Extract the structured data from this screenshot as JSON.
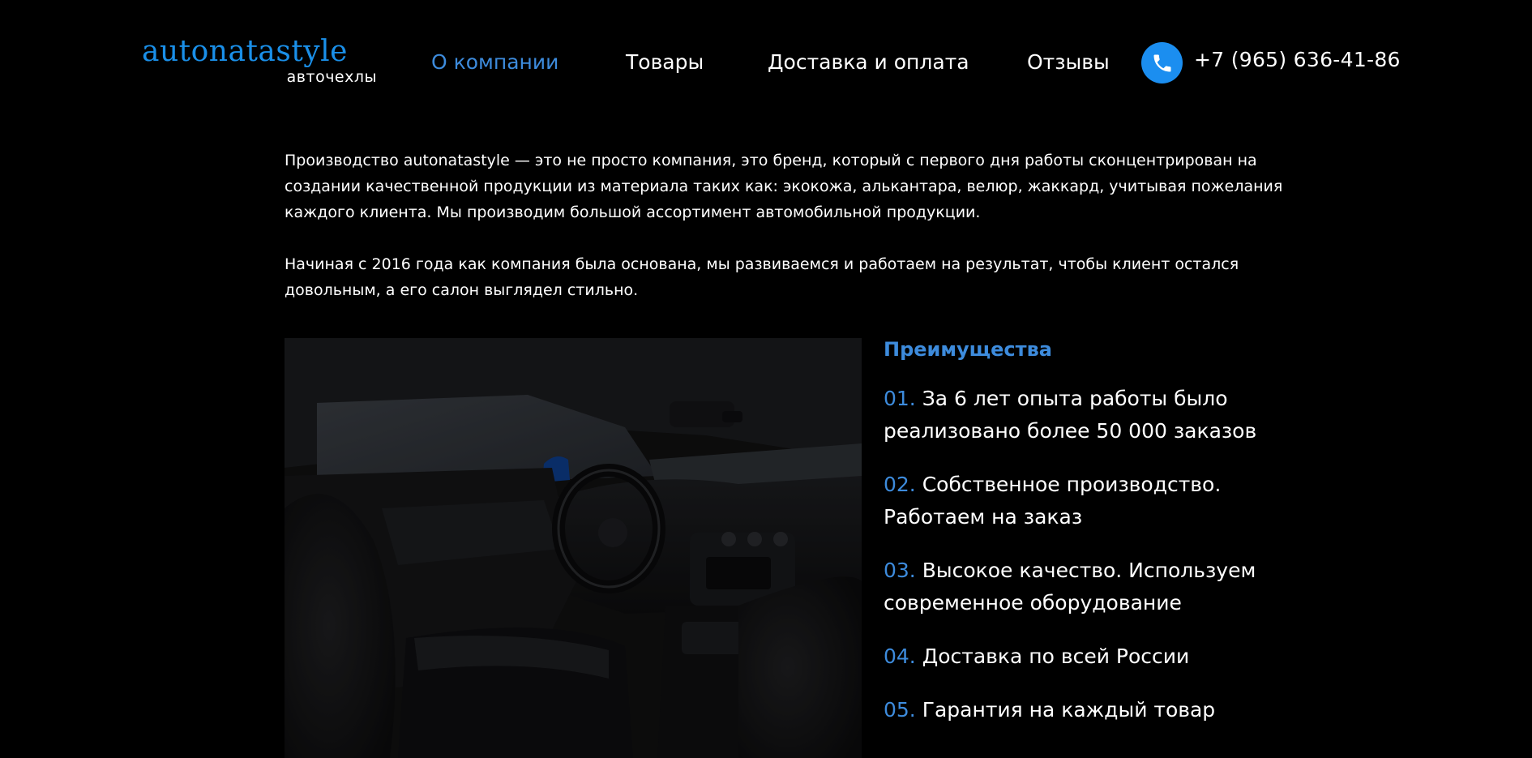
{
  "header": {
    "logo_main": "autonatastyle",
    "logo_sub": "авточехлы",
    "nav": [
      {
        "label": "О компании",
        "active": true
      },
      {
        "label": "Товары",
        "active": false
      },
      {
        "label": "Доставка и оплата",
        "active": false
      },
      {
        "label": "Отзывы",
        "active": false
      }
    ],
    "phone": "+7 (965) 636-41-86",
    "phone_icon": "phone-icon"
  },
  "intro": {
    "paragraph1": "Производство autonatastyle — это не просто компания, это бренд, который с первого дня работы сконцентрирован на создании качественной продукции из материала таких как: экокожа, алькантара, велюр, жаккард, учитывая пожелания каждого клиента. Мы производим большой ассортимент автомобильной продукции.",
    "paragraph2": "Начиная с 2016 года как компания была основана, мы развиваемся и работаем на результат, чтобы клиент остался довольным, а его салон выглядел стильно."
  },
  "advantages": {
    "title": "Преимущества",
    "items": [
      {
        "num": "01.",
        "text": "За 6 лет опыта работы было реализовано более 50 000 заказов"
      },
      {
        "num": "02.",
        "text": "Собственное производство. Работаем на заказ"
      },
      {
        "num": "03.",
        "text": "Высокое качество. Используем современное оборудование"
      },
      {
        "num": "04.",
        "text": "Доставка по всей России"
      },
      {
        "num": "05.",
        "text": "Гарантия на каждый товар"
      }
    ]
  },
  "colors": {
    "background": "#000000",
    "accent": "#3d8bdc",
    "logo": "#1a8fe8",
    "phone_circle": "#1b8ef0",
    "text": "#ffffff"
  }
}
